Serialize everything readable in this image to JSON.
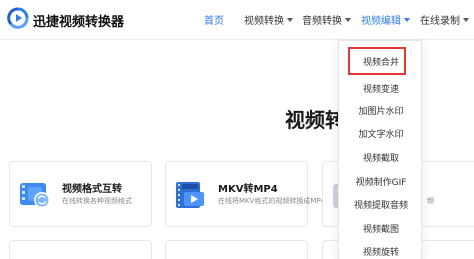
{
  "header": {
    "brand": "迅捷视频转换器",
    "nav": [
      {
        "label": "首页",
        "active": true
      },
      {
        "label": "视频转换"
      },
      {
        "label": "音频转换"
      },
      {
        "label": "视频编辑",
        "open": true
      },
      {
        "label": "在线录制"
      }
    ]
  },
  "main": {
    "section_title": "视频转",
    "cards": [
      {
        "title": "视频格式互转",
        "desc": "在线转换各种视频格式",
        "icon": "film-convert-icon"
      },
      {
        "title": "MKV转MP4",
        "desc": "在线将MKV格式的视频转换成MP4",
        "icon": "mkv-mp4-icon"
      },
      {
        "title": "",
        "desc": "频",
        "icon": "file-icon"
      }
    ]
  },
  "dropdown": {
    "items": [
      {
        "label": "视频合并",
        "highlighted": true
      },
      {
        "label": "视频变速"
      },
      {
        "label": "加图片水印"
      },
      {
        "label": "加文字水印"
      },
      {
        "label": "视频截取"
      },
      {
        "label": "视频制作GIF"
      },
      {
        "label": "视频提取音频"
      },
      {
        "label": "视频截图"
      },
      {
        "label": "视频旋转"
      }
    ]
  },
  "colors": {
    "accent": "#2f7cf6",
    "highlight": "#e53935"
  }
}
